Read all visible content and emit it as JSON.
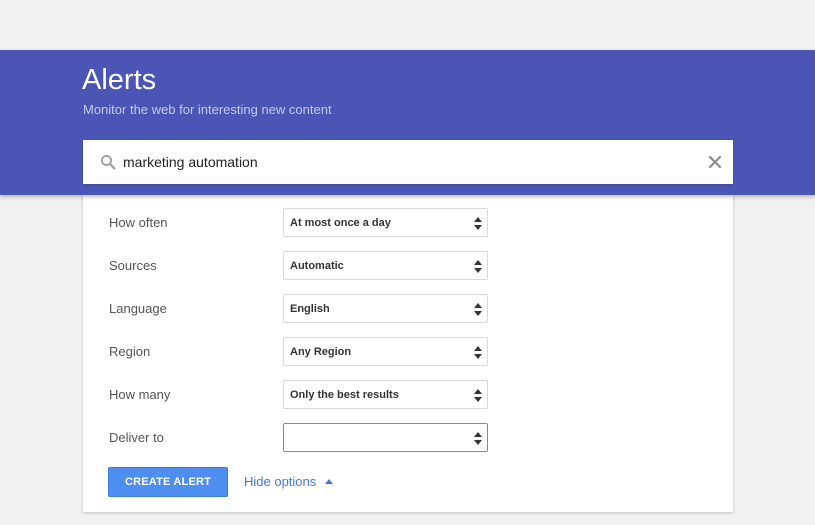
{
  "header": {
    "title": "Alerts",
    "subtitle": "Monitor the web for interesting new content"
  },
  "search": {
    "value": "marketing automation",
    "icon": "search-icon",
    "clear_icon": "close-icon"
  },
  "options": [
    {
      "label": "How often",
      "value": "At most once a day"
    },
    {
      "label": "Sources",
      "value": "Automatic"
    },
    {
      "label": "Language",
      "value": "English"
    },
    {
      "label": "Region",
      "value": "Any Region"
    },
    {
      "label": "How many",
      "value": "Only the best results"
    },
    {
      "label": "Deliver to",
      "value": ""
    }
  ],
  "actions": {
    "create_label": "CREATE ALERT",
    "hide_options_label": "Hide options"
  },
  "colors": {
    "header_bg": "#4a55b5",
    "button_bg": "#4d8ef0",
    "link": "#4376d6",
    "focus_border": "#4d90fe"
  }
}
